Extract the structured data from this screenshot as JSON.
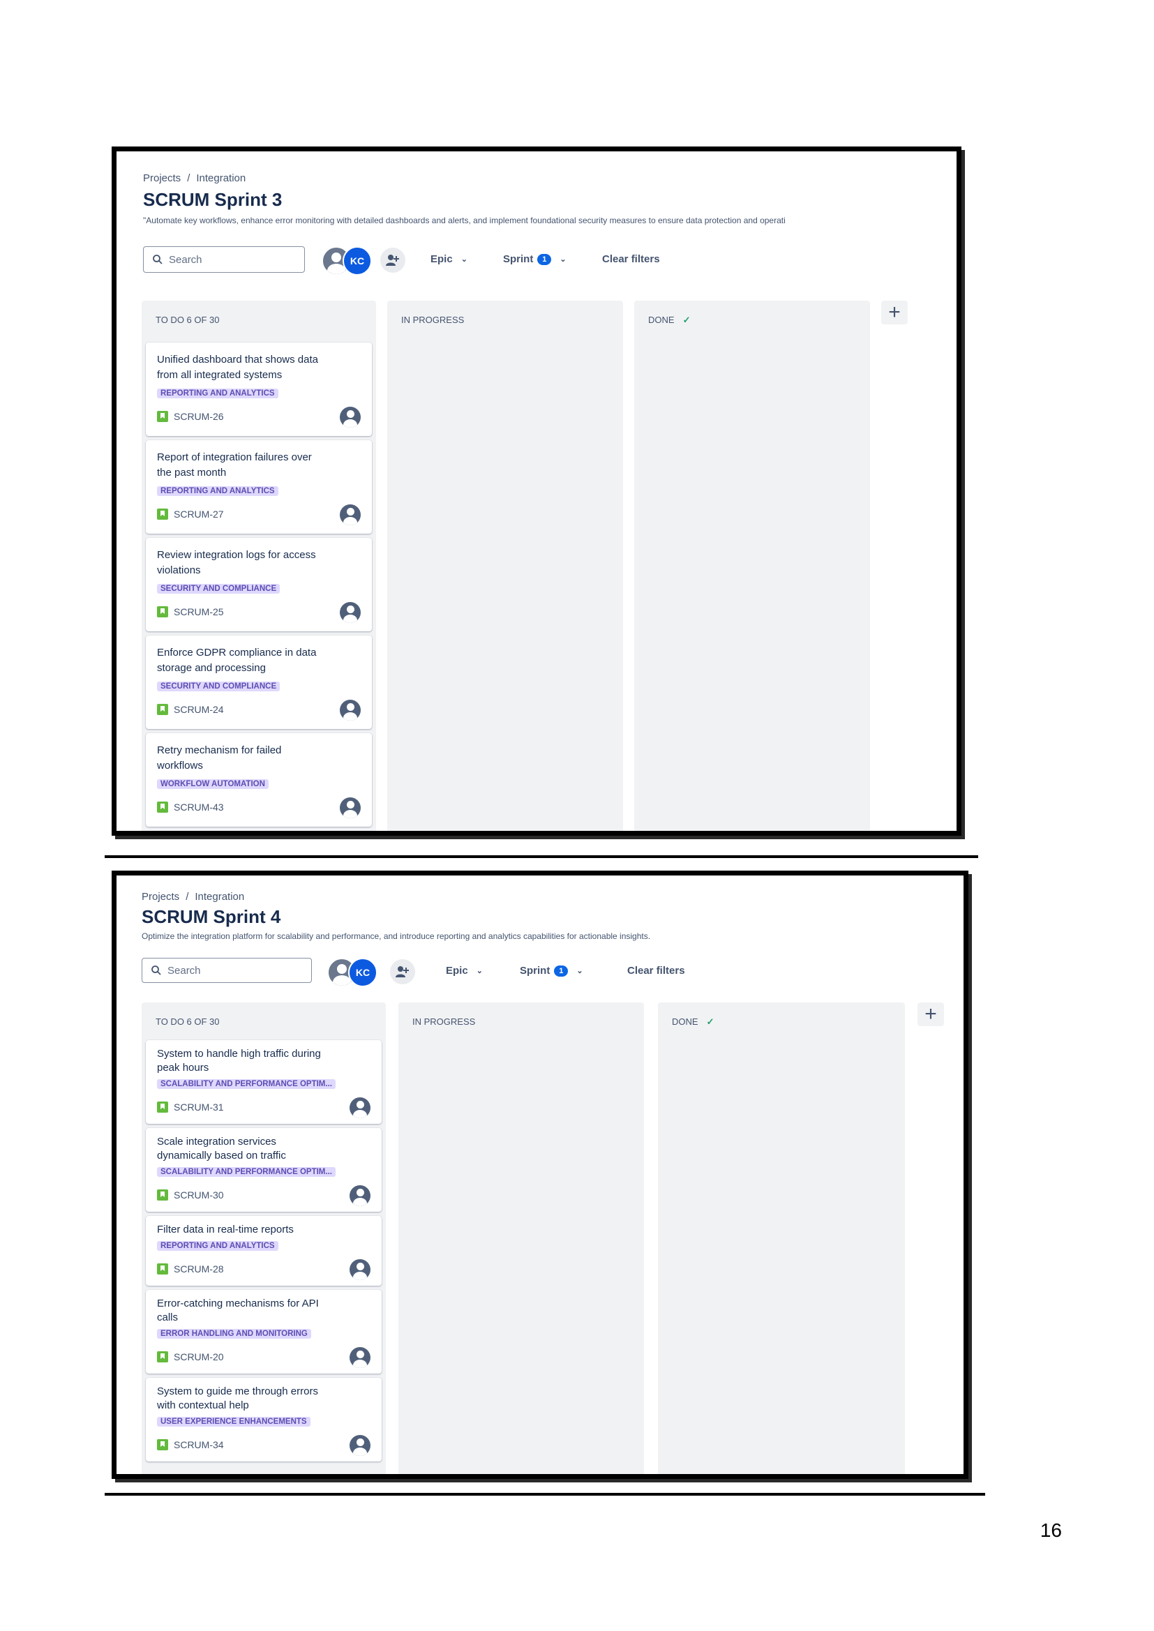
{
  "sprint3": {
    "breadcrumb": {
      "projects": "Projects",
      "separator": "/",
      "project": "Integration"
    },
    "title": "SCRUM Sprint 3",
    "description": "\"Automate key workflows, enhance error monitoring with detailed dashboards and alerts, and implement foundational security measures to ensure data protection and operati",
    "search_placeholder": "Search",
    "avatar_initials": "KC",
    "filters": {
      "epic": "Epic",
      "sprint": "Sprint",
      "sprint_count": "1",
      "clear": "Clear filters"
    },
    "columns": {
      "todo": "TO DO 6 OF 30",
      "inprogress": "IN PROGRESS",
      "done": "DONE",
      "done_check": "✓"
    },
    "add_column": "+",
    "cards": [
      {
        "title": "Unified dashboard that shows data from all integrated systems",
        "tag": "REPORTING AND ANALYTICS",
        "key": "SCRUM-26"
      },
      {
        "title": "Report of integration failures over the past month",
        "tag": "REPORTING AND ANALYTICS",
        "key": "SCRUM-27"
      },
      {
        "title": "Review integration logs for access violations",
        "tag": "SECURITY AND COMPLIANCE",
        "key": "SCRUM-25"
      },
      {
        "title": "Enforce GDPR compliance in data storage and processing",
        "tag": "SECURITY AND COMPLIANCE",
        "key": "SCRUM-24"
      },
      {
        "title": "Retry mechanism for failed workflows",
        "tag": "WORKFLOW AUTOMATION",
        "key": "SCRUM-43"
      }
    ]
  },
  "sprint4": {
    "breadcrumb": {
      "projects": "Projects",
      "separator": "/",
      "project": "Integration"
    },
    "title": "SCRUM Sprint 4",
    "description": "Optimize the integration platform for scalability and performance, and introduce reporting and analytics capabilities for actionable insights.",
    "search_placeholder": "Search",
    "avatar_initials": "KC",
    "filters": {
      "epic": "Epic",
      "sprint": "Sprint",
      "sprint_count": "1",
      "clear": "Clear filters"
    },
    "columns": {
      "todo": "TO DO 6 OF 30",
      "inprogress": "IN PROGRESS",
      "done": "DONE",
      "done_check": "✓"
    },
    "add_column": "+",
    "cards": [
      {
        "title": "System to handle high traffic during peak hours",
        "tag": "SCALABILITY AND PERFORMANCE OPTIM...",
        "key": "SCRUM-31"
      },
      {
        "title": "Scale integration services dynamically based on traffic",
        "tag": "SCALABILITY AND PERFORMANCE OPTIM...",
        "key": "SCRUM-30"
      },
      {
        "title": "Filter data in real-time reports",
        "tag": "REPORTING AND ANALYTICS",
        "key": "SCRUM-28"
      },
      {
        "title": "Error-catching mechanisms for API calls",
        "tag": "ERROR HANDLING AND MONITORING",
        "key": "SCRUM-20"
      },
      {
        "title": "System to guide me through errors with contextual help",
        "tag": "USER EXPERIENCE ENHANCEMENTS",
        "key": "SCRUM-34"
      }
    ]
  },
  "page_number": "16"
}
